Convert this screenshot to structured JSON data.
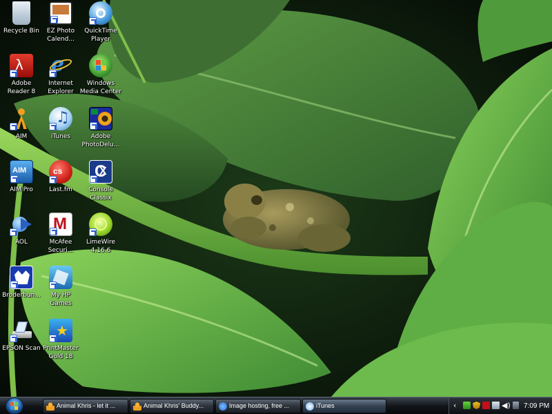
{
  "desktop": {
    "icons": [
      {
        "id": "recycle-bin",
        "label": "Recycle Bin",
        "icon": "recycle-bin-icon"
      },
      {
        "id": "ez-photo",
        "label": "EZ Photo\nCalend...",
        "icon": "ez-photo-calendar-icon"
      },
      {
        "id": "quicktime",
        "label": "QuickTime\nPlayer",
        "icon": "quicktime-icon"
      },
      {
        "id": "adobe-reader",
        "label": "Adobe\nReader 8",
        "icon": "adobe-reader-icon"
      },
      {
        "id": "internet-explorer",
        "label": "Internet\nExplorer",
        "icon": "internet-explorer-icon"
      },
      {
        "id": "windows-media-center",
        "label": "Windows\nMedia Center",
        "icon": "windows-media-center-icon"
      },
      {
        "id": "aim",
        "label": "AIM",
        "icon": "aim-icon"
      },
      {
        "id": "itunes",
        "label": "iTunes",
        "icon": "itunes-icon"
      },
      {
        "id": "adobe-photodeluxe",
        "label": "Adobe\nPhotoDelu...",
        "icon": "adobe-photodeluxe-icon"
      },
      {
        "id": "aim-pro",
        "label": "AIM Pro",
        "icon": "aim-pro-icon"
      },
      {
        "id": "lastfm",
        "label": "Last.fm",
        "icon": "lastfm-icon"
      },
      {
        "id": "console-classix",
        "label": "Console\nClassix",
        "icon": "console-classix-icon"
      },
      {
        "id": "aol",
        "label": "AOL",
        "icon": "aol-icon"
      },
      {
        "id": "mcafee",
        "label": "McAfee\nSecuri...",
        "icon": "mcafee-icon"
      },
      {
        "id": "limewire",
        "label": "LimeWire\n4.16.6",
        "icon": "limewire-icon"
      },
      {
        "id": "broderbund",
        "label": "Broderbun...",
        "icon": "broderbund-icon"
      },
      {
        "id": "my-hp-games",
        "label": "My HP\nGames",
        "icon": "hp-games-icon"
      },
      {
        "id": "epson-scan",
        "label": "EPSON Scan",
        "icon": "epson-scan-icon"
      },
      {
        "id": "printmaster",
        "label": "PrintMaster\nGold 18",
        "icon": "printmaster-icon"
      }
    ]
  },
  "taskbar": {
    "start_icon": "windows-start-orb-icon",
    "buttons": [
      {
        "label": "Animal Khris - let it ...",
        "icon": "aim-icon"
      },
      {
        "label": "Animal Khris' Buddy...",
        "icon": "aim-icon"
      },
      {
        "label": "Image hosting, free ...",
        "icon": "internet-explorer-icon"
      },
      {
        "label": "iTunes",
        "icon": "itunes-icon"
      }
    ],
    "tray": {
      "icons": [
        "chevron-left-icon",
        "network-icon",
        "shield-icon",
        "mcafee-icon",
        "printer-icon",
        "volume-icon",
        "power-icon"
      ],
      "clock": "7:09 PM"
    }
  },
  "colors": {
    "accent": "#2a6fb8",
    "taskbar": "#111417",
    "leaf_light": "#7fcf4a",
    "leaf_dark": "#2e5a2a"
  }
}
